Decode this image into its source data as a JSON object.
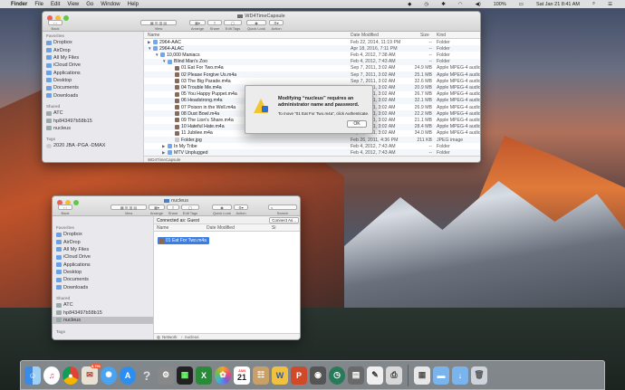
{
  "menubar": {
    "apple": "",
    "items": [
      "Finder",
      "File",
      "Edit",
      "View",
      "Go",
      "Window",
      "Help"
    ],
    "battery": "100%",
    "clock": "Sat Jan 21  8:41 AM"
  },
  "win1": {
    "title": "WD4TimeCapsule",
    "toolbar": {
      "back": "Back",
      "view": "View",
      "arrange": "Arrange",
      "share": "Share",
      "edit_tags": "Edit Tags",
      "quick_look": "Quick Look",
      "action": "Action"
    },
    "sidebar": {
      "favorites_header": "Favorites",
      "favorites": [
        "Dropbox",
        "AirDrop",
        "All My Files",
        "iCloud Drive",
        "Applications",
        "Desktop",
        "Documents",
        "Downloads"
      ],
      "shared_header": "Shared",
      "shared": [
        "ATC",
        "hp843497b58b15",
        "nucleus"
      ],
      "tags_header": "Tags",
      "tags": [
        "2020 JBA -PGA -DMAX"
      ]
    },
    "columns": {
      "name": "Name",
      "date": "Date Modified",
      "size": "Size",
      "kind": "Kind"
    },
    "rows": [
      {
        "name": "2964-AAC",
        "date": "Feb 22, 2014, 11:19 PM",
        "size": "--",
        "kind": "Folder",
        "type": "folder",
        "indent": 0,
        "tri": "▶"
      },
      {
        "name": "2964-ALAC",
        "date": "Apr 18, 2016, 7:11 PM",
        "size": "--",
        "kind": "Folder",
        "type": "folder",
        "indent": 0,
        "tri": "▼"
      },
      {
        "name": "10,000 Maniacs",
        "date": "Feb 4, 2012, 7:38 AM",
        "size": "--",
        "kind": "Folder",
        "type": "folder",
        "indent": 1,
        "tri": "▼"
      },
      {
        "name": "Blind Man's Zoo",
        "date": "Feb 4, 2012, 7:43 AM",
        "size": "--",
        "kind": "Folder",
        "type": "folder",
        "indent": 2,
        "tri": "▼"
      },
      {
        "name": "01 Eat For Two.m4a",
        "date": "Sep 7, 2011, 3:02 AM",
        "size": "24.9 MB",
        "kind": "Apple MPEG-4 audio",
        "type": "audio",
        "indent": 3,
        "tri": ""
      },
      {
        "name": "02 Please Forgive Us.m4a",
        "date": "Sep 7, 2011, 3:02 AM",
        "size": "25.1 MB",
        "kind": "Apple MPEG-4 audio",
        "type": "audio",
        "indent": 3,
        "tri": ""
      },
      {
        "name": "03 The Big Parade.m4a",
        "date": "Sep 7, 2011, 3:02 AM",
        "size": "32.6 MB",
        "kind": "Apple MPEG-4 audio",
        "type": "audio",
        "indent": 3,
        "tri": ""
      },
      {
        "name": "04 Trouble Me.m4a",
        "date": "Sep 7, 2011, 3:02 AM",
        "size": "20.9 MB",
        "kind": "Apple MPEG-4 audio",
        "type": "audio",
        "indent": 3,
        "tri": ""
      },
      {
        "name": "05 You Happy Puppet.m4a",
        "date": "Sep 7, 2011, 3:02 AM",
        "size": "26.7 MB",
        "kind": "Apple MPEG-4 audio",
        "type": "audio",
        "indent": 3,
        "tri": ""
      },
      {
        "name": "06 Headstrong.m4a",
        "date": "Sep 7, 2011, 3:02 AM",
        "size": "32.1 MB",
        "kind": "Apple MPEG-4 audio",
        "type": "audio",
        "indent": 3,
        "tri": ""
      },
      {
        "name": "07 Poison in the Well.m4a",
        "date": "Sep 7, 2011, 3:02 AM",
        "size": "26.9 MB",
        "kind": "Apple MPEG-4 audio",
        "type": "audio",
        "indent": 3,
        "tri": ""
      },
      {
        "name": "08 Dust Bowl.m4a",
        "date": "Sep 7, 2011, 3:02 AM",
        "size": "22.2 MB",
        "kind": "Apple MPEG-4 audio",
        "type": "audio",
        "indent": 3,
        "tri": ""
      },
      {
        "name": "09 The Lion's Share.m4a",
        "date": "Sep 7, 2011, 3:02 AM",
        "size": "21.1 MB",
        "kind": "Apple MPEG-4 audio",
        "type": "audio",
        "indent": 3,
        "tri": ""
      },
      {
        "name": "10 Hateful Hate.m4a",
        "date": "Sep 7, 2011, 3:02 AM",
        "size": "28.4 MB",
        "kind": "Apple MPEG-4 audio",
        "type": "audio",
        "indent": 3,
        "tri": ""
      },
      {
        "name": "11 Jubilee.m4a",
        "date": "Sep 7, 2011, 3:02 AM",
        "size": "34.0 MB",
        "kind": "Apple MPEG-4 audio",
        "type": "audio",
        "indent": 3,
        "tri": ""
      },
      {
        "name": "Folder.jpg",
        "date": "Feb 26, 2011, 4:36 PM",
        "size": "211 KB",
        "kind": "JPEG image",
        "type": "img",
        "indent": 3,
        "tri": ""
      },
      {
        "name": "In My Tribe",
        "date": "Feb 4, 2012, 7:43 AM",
        "size": "--",
        "kind": "Folder",
        "type": "folder",
        "indent": 2,
        "tri": "▶"
      },
      {
        "name": "MTV Unplugged",
        "date": "Feb 4, 2012, 7:43 AM",
        "size": "--",
        "kind": "Folder",
        "type": "folder",
        "indent": 2,
        "tri": "▶"
      },
      {
        "name": "Our Time in Eden",
        "date": "Feb 4, 2012, 7:43 AM",
        "size": "--",
        "kind": "Folder",
        "type": "folder",
        "indent": 2,
        "tri": "▶"
      }
    ],
    "path": "WD4TimeCapsule"
  },
  "dialog": {
    "title": "Modifying “nucleus” requires an administrator name and password.",
    "message": "To move “01 Eat For Two.m4a”, click Authenticate.",
    "ok": "OK"
  },
  "win2": {
    "title": "nucleus",
    "toolbar": {
      "back": "Back",
      "view": "View",
      "arrange": "Arrange",
      "share": "Share",
      "edit_tags": "Edit Tags",
      "quick_look": "Quick Look",
      "action": "Action",
      "search": "Search"
    },
    "connected": "Connected as: Guest",
    "connect_as": "Connect As...",
    "sidebar": {
      "favorites_header": "Favorites",
      "favorites": [
        "Dropbox",
        "AirDrop",
        "All My Files",
        "iCloud Drive",
        "Applications",
        "Desktop",
        "Documents",
        "Downloads"
      ],
      "shared_header": "Shared",
      "shared": [
        "ATC",
        "hp843497b58b15",
        "nucleus"
      ],
      "tags_header": "Tags"
    },
    "columns": {
      "name": "Name",
      "date": "Date Modified",
      "size": "Si"
    },
    "dragged": "01 Eat For Two.m4a",
    "path": {
      "network": "Network",
      "nucleus": "nucleus"
    }
  },
  "dock": {
    "calendar_month": "JAN",
    "calendar_day": "21",
    "badge": "8,751"
  }
}
